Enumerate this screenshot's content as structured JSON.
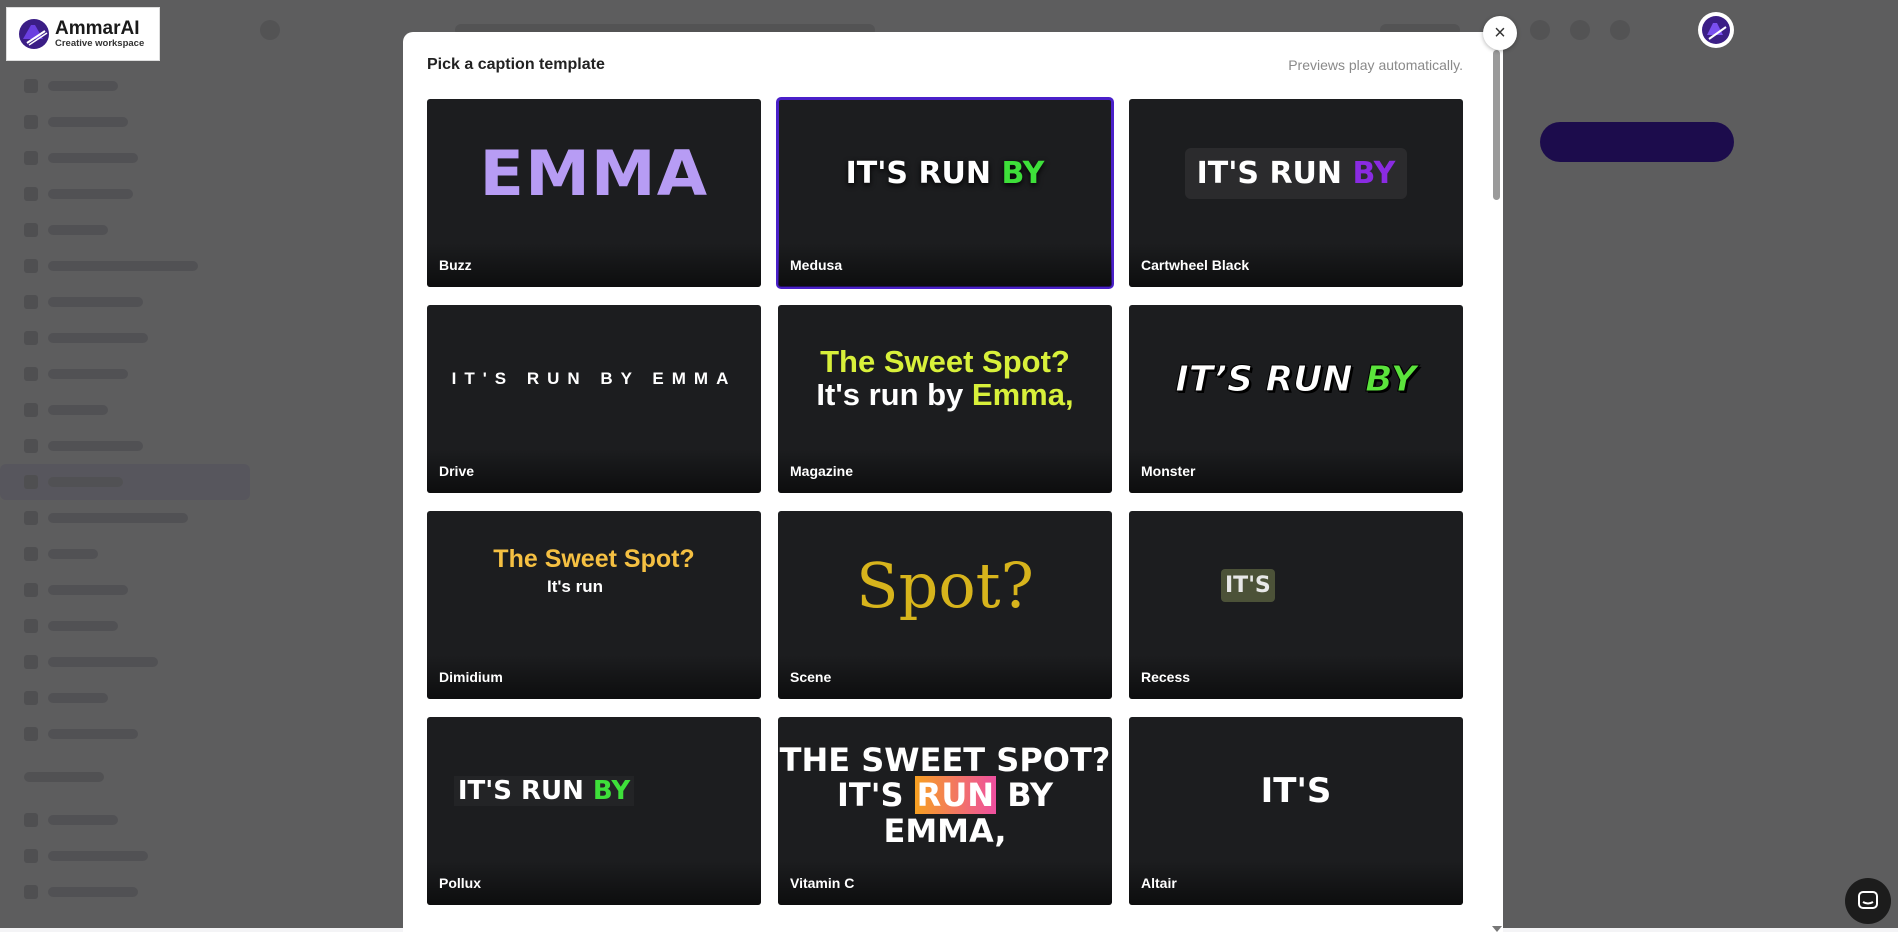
{
  "app": {
    "logo_title": "AmmarAI",
    "logo_subtitle": "Creative workspace",
    "accent_color": "#4a20c9"
  },
  "modal": {
    "title": "Pick a caption template",
    "hint": "Previews play automatically.",
    "close_label": "×",
    "selected_template": "Medusa",
    "templates": [
      {
        "name": "Buzz",
        "preview": [
          "EMMA"
        ]
      },
      {
        "name": "Medusa",
        "preview": [
          "IT'S RUN ",
          "BY"
        ]
      },
      {
        "name": "Cartwheel Black",
        "preview": [
          "IT'S RUN ",
          "BY"
        ]
      },
      {
        "name": "Drive",
        "preview": [
          "IT'S RUN BY EMMA"
        ]
      },
      {
        "name": "Magazine",
        "preview": [
          "The Sweet Spot?",
          "It's run by ",
          "Emma,"
        ]
      },
      {
        "name": "Monster",
        "preview": [
          "IT’S RUN ",
          "BY"
        ]
      },
      {
        "name": "Dimidium",
        "preview": [
          "The Sweet Spot?",
          "It's run"
        ]
      },
      {
        "name": "Scene",
        "preview": [
          "Spot?"
        ]
      },
      {
        "name": "Recess",
        "preview": [
          "IT'S"
        ]
      },
      {
        "name": "Pollux",
        "preview": [
          "IT'S RUN ",
          "BY"
        ]
      },
      {
        "name": "Vitamin C",
        "preview": [
          "THE SWEET SPOT?",
          "IT'S ",
          "RUN",
          " BY EMMA,"
        ]
      },
      {
        "name": "Altair",
        "preview": [
          "IT'S"
        ]
      }
    ]
  }
}
